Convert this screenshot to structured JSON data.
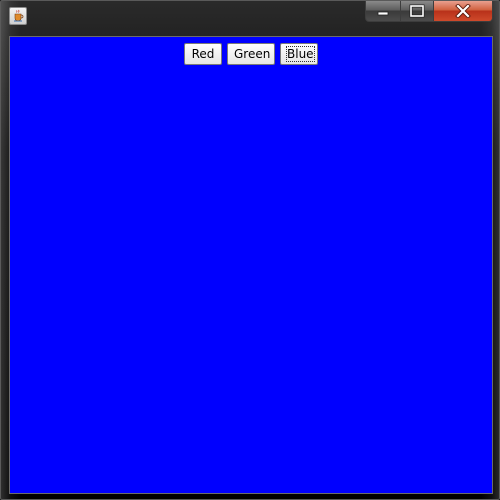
{
  "window": {
    "background_color": "#0000ff",
    "caption": {
      "minimize_icon": "minimize-icon",
      "maximize_icon": "maximize-icon",
      "close_icon": "close-icon"
    },
    "app_icon": "java-cup-icon"
  },
  "buttons": [
    {
      "label": "Red"
    },
    {
      "label": "Green"
    },
    {
      "label": "Blue",
      "focused": true
    }
  ]
}
